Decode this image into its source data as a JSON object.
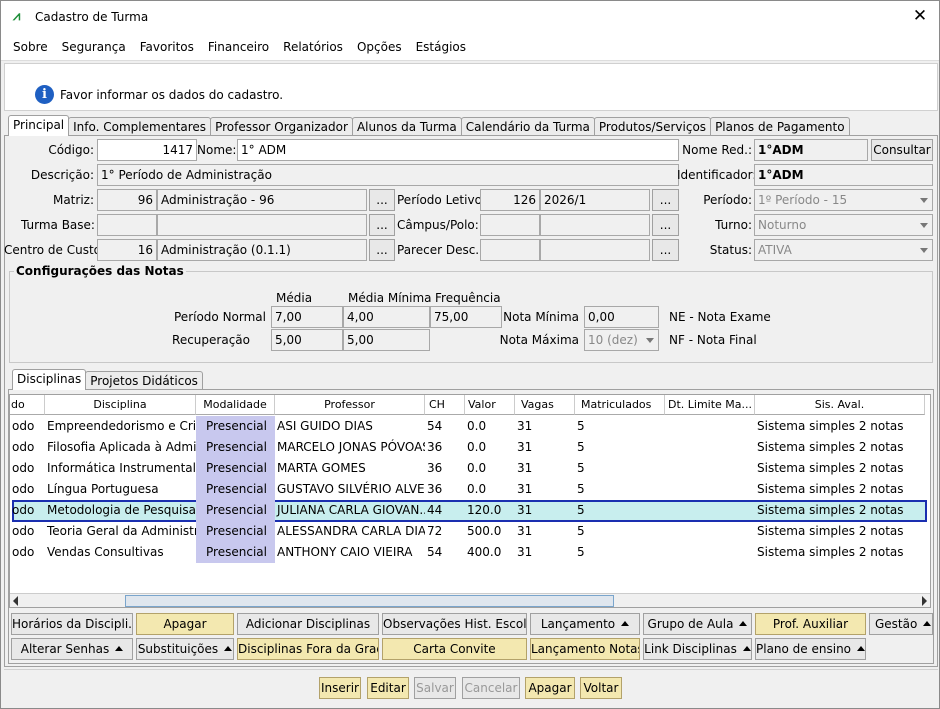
{
  "window": {
    "title": "Cadastro de Turma"
  },
  "menu": [
    "Sobre",
    "Segurança",
    "Favoritos",
    "Financeiro",
    "Relatórios",
    "Opções",
    "Estágios"
  ],
  "message": "Favor informar os dados do cadastro.",
  "tabs": [
    "Principal",
    "Info. Complementares",
    "Professor Organizador",
    "Alunos da Turma",
    "Calendário da Turma",
    "Produtos/Serviços",
    "Planos de Pagamento"
  ],
  "form": {
    "codigo_label": "Código:",
    "codigo": "1417",
    "nome_label": "Nome:",
    "nome": "1° ADM",
    "nome_red_label": "Nome Red.:",
    "nome_red": "1°ADM",
    "consultar": "Consultar",
    "descricao_label": "Descrição:",
    "descricao": "1° Período de Administração",
    "identificador_label": "Identificador:",
    "identificador": "1°ADM",
    "matriz_label": "Matriz:",
    "matriz_code": "96",
    "matriz_name": "Administração - 96",
    "periodo_letivo_label": "Período Letivo:",
    "periodo_letivo_code": "126",
    "periodo_letivo": "2026/1",
    "periodo_label": "Período:",
    "periodo": "1º Período - 15",
    "turma_base_label": "Turma Base:",
    "campus_label": "Câmpus/Polo:",
    "turno_label": "Turno:",
    "turno": "Noturno",
    "centro_custo_label": "Centro de Custo:",
    "centro_custo_code": "16",
    "centro_custo": "Administração (0.1.1)",
    "parecer_label": "Parecer Desc.:",
    "status_label": "Status:",
    "status": "ATIVA",
    "ellipsis": "..."
  },
  "notas": {
    "title": "Configurações das Notas",
    "h_media": "Média",
    "h_media_min": "Média Mínima",
    "h_freq": "Frequência",
    "periodo_normal": "Período Normal",
    "pn_media": "7,00",
    "pn_media_min": "4,00",
    "pn_freq": "75,00",
    "recuperacao": "Recuperação",
    "rec_media": "5,00",
    "rec_media_min": "5,00",
    "nota_minima_label": "Nota Mínima",
    "nota_minima": "0,00",
    "nota_maxima_label": "Nota Máxima",
    "nota_maxima": "10 (dez)",
    "ne": "NE - Nota Exame",
    "nf": "NF - Nota Final"
  },
  "subtabs": [
    "Disciplinas",
    "Projetos Didáticos"
  ],
  "grid": {
    "headers": [
      "do",
      "Disciplina",
      "Modalidade",
      "Professor",
      "CH",
      "Valor",
      "Vagas",
      "Matriculados",
      "Dt. Limite Ma...",
      "Sis. Aval."
    ],
    "rows": [
      [
        "odo",
        "Empreendedorismo e Criaçã",
        "Presencial",
        "ASI GUIDO DIAS",
        "54",
        "0.0",
        "31",
        "5",
        "",
        "Sistema simples 2 notas"
      ],
      [
        "odo",
        "Filosofia Aplicada à Adminis",
        "Presencial",
        "MARCELO JONAS PÓVOAS",
        "36",
        "0.0",
        "31",
        "5",
        "",
        "Sistema simples 2 notas"
      ],
      [
        "odo",
        "Informática Instrumental",
        "Presencial",
        "MARTA GOMES",
        "36",
        "0.0",
        "31",
        "5",
        "",
        "Sistema simples 2 notas"
      ],
      [
        "odo",
        "Língua Portuguesa",
        "Presencial",
        "GUSTAVO SILVÉRIO ALVES",
        "36",
        "0.0",
        "31",
        "5",
        "",
        "Sistema simples 2 notas"
      ],
      [
        "odo",
        "Metodologia de Pesquisa",
        "Presencial",
        "JULIANA CARLA GIOVAN...",
        "44",
        "120.0",
        "31",
        "5",
        "",
        "Sistema simples 2 notas"
      ],
      [
        "odo",
        "Teoria Geral da Administraçã",
        "Presencial",
        "ALESSANDRA CARLA DIAS",
        "72",
        "500.0",
        "31",
        "5",
        "",
        "Sistema simples 2 notas"
      ],
      [
        "odo",
        "Vendas Consultivas",
        "Presencial",
        "ANTHONY CAIO VIEIRA",
        "54",
        "400.0",
        "31",
        "5",
        "",
        "Sistema simples 2 notas"
      ]
    ]
  },
  "actions_row1": [
    "Horários da Discipli...",
    "Apagar",
    "Adicionar Disciplinas",
    "Observações Hist. Escolar",
    "Lançamento",
    "Grupo de Aula",
    "Prof. Auxiliar",
    "Gestão"
  ],
  "actions_row2": [
    "Alterar Senhas",
    "Substituições",
    "Disciplinas Fora da Grade",
    "Carta Convite",
    "Lançamento Notas",
    "Link Disciplinas",
    "Plano de ensino"
  ],
  "bottom": [
    "Inserir",
    "Editar",
    "Salvar",
    "Cancelar",
    "Apagar",
    "Voltar"
  ]
}
